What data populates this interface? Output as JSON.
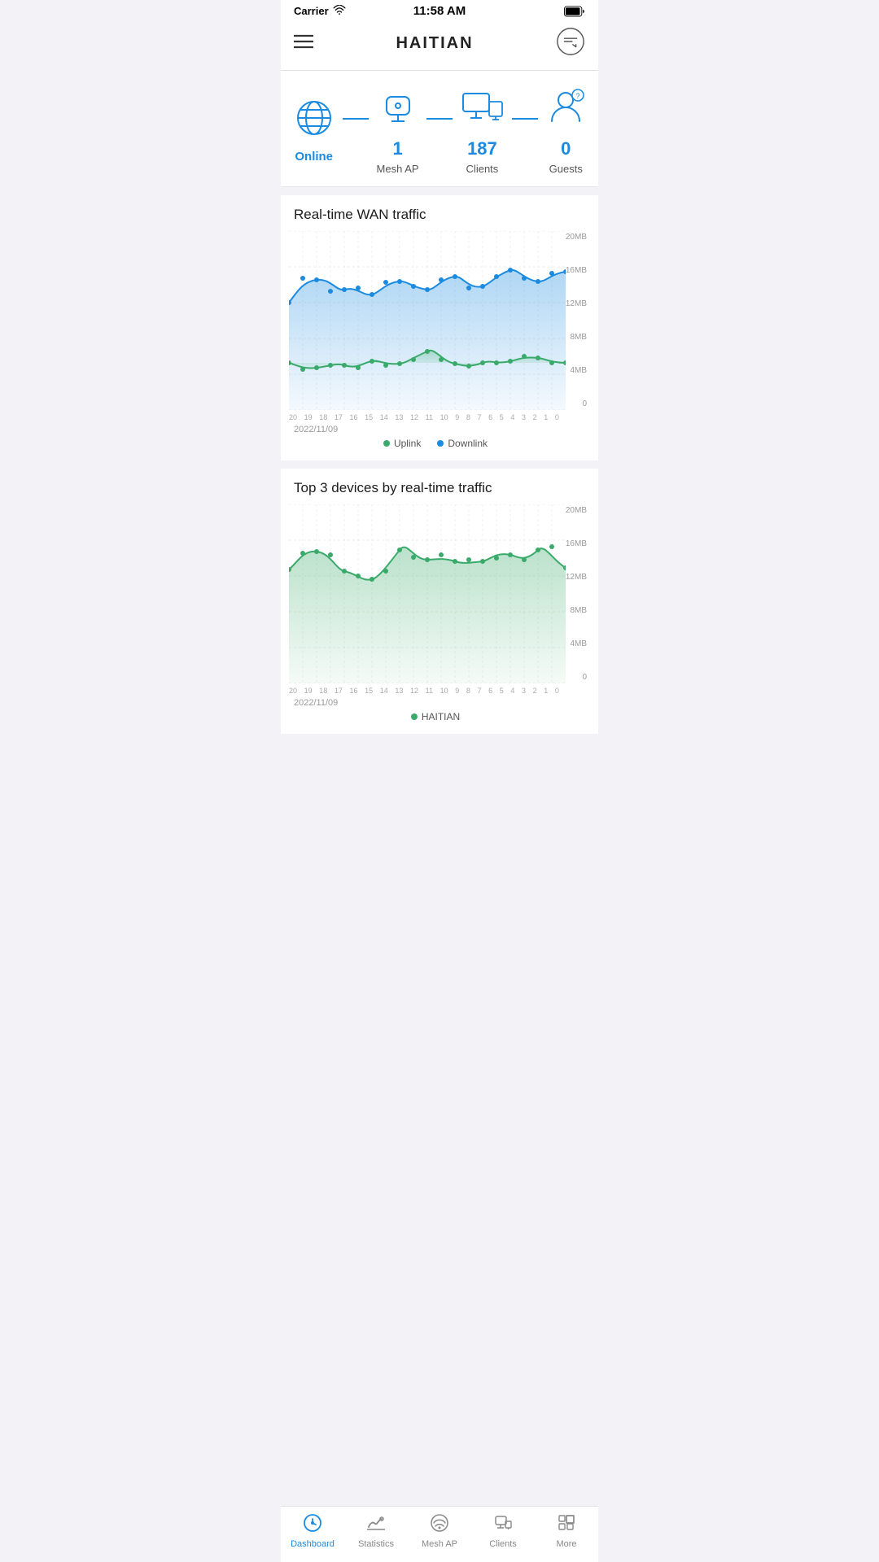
{
  "status_bar": {
    "carrier": "Carrier",
    "time": "11:58 AM"
  },
  "header": {
    "title": "HAITIAN"
  },
  "network": {
    "status_label": "Online",
    "mesh_ap_value": "1",
    "mesh_ap_label": "Mesh AP",
    "clients_value": "187",
    "clients_label": "Clients",
    "guests_value": "0",
    "guests_label": "Guests"
  },
  "wan_chart": {
    "title": "Real-time WAN traffic",
    "date": "2022/11/09",
    "y_labels": [
      "20MB",
      "16MB",
      "12MB",
      "8MB",
      "4MB",
      "0"
    ],
    "x_labels": [
      "20",
      "19",
      "18",
      "17",
      "16",
      "15",
      "14",
      "13",
      "12",
      "11",
      "10",
      "9",
      "8",
      "7",
      "6",
      "5",
      "4",
      "3",
      "2",
      "1",
      "0"
    ],
    "legend_uplink": "Uplink",
    "legend_downlink": "Downlink",
    "uplink_color": "#3aaa6a",
    "downlink_color": "#1a8be0"
  },
  "devices_chart": {
    "title": "Top 3 devices by real-time traffic",
    "date": "2022/11/09",
    "y_labels": [
      "20MB",
      "16MB",
      "12MB",
      "8MB",
      "4MB",
      "0"
    ],
    "x_labels": [
      "20",
      "19",
      "18",
      "17",
      "16",
      "15",
      "14",
      "13",
      "12",
      "11",
      "10",
      "9",
      "8",
      "7",
      "6",
      "5",
      "4",
      "3",
      "2",
      "1",
      "0"
    ],
    "legend_label": "HAITIAN",
    "legend_color": "#3aaa6a"
  },
  "tabs": [
    {
      "id": "dashboard",
      "label": "Dashboard",
      "active": true
    },
    {
      "id": "statistics",
      "label": "Statistics",
      "active": false
    },
    {
      "id": "mesh_ap",
      "label": "Mesh AP",
      "active": false
    },
    {
      "id": "clients",
      "label": "Clients",
      "active": false
    },
    {
      "id": "more",
      "label": "More",
      "active": false
    }
  ]
}
